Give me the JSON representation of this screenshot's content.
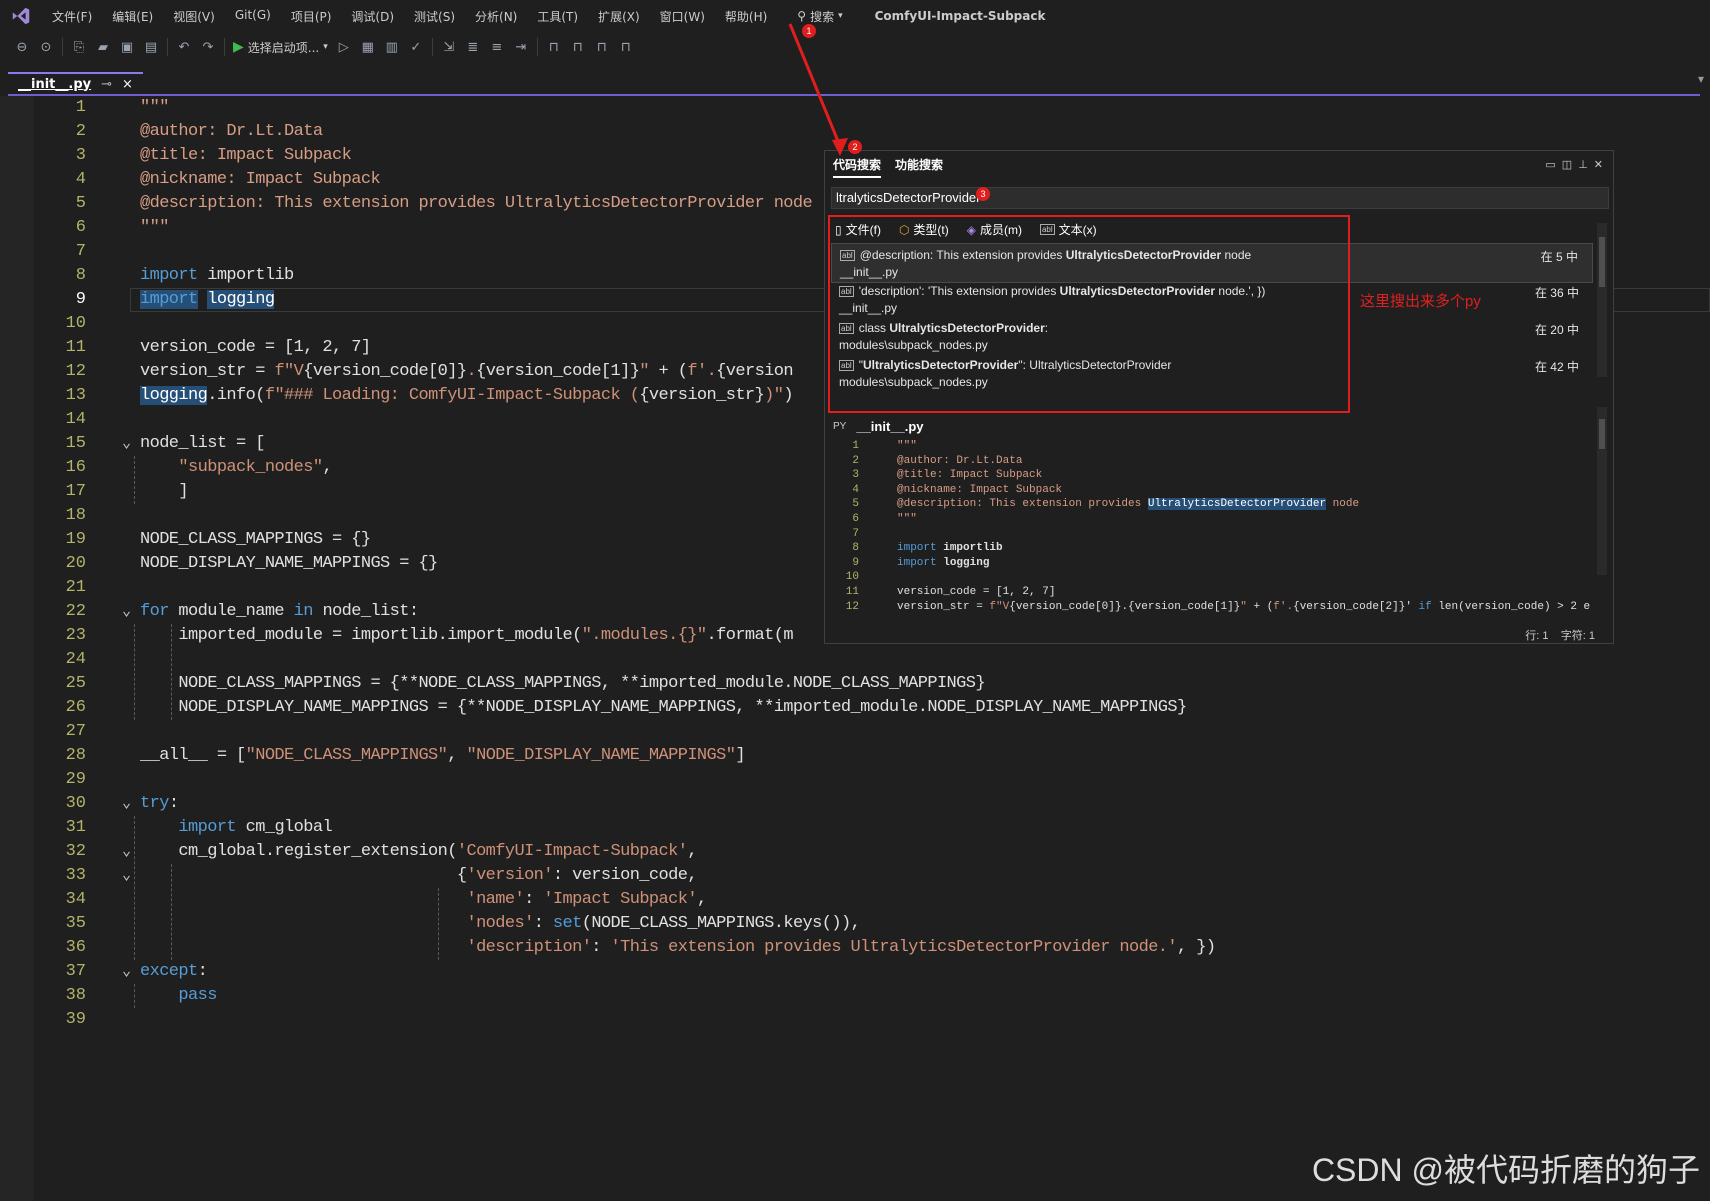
{
  "menubar": {
    "items": [
      "文件(F)",
      "编辑(E)",
      "视图(V)",
      "Git(G)",
      "项目(P)",
      "调试(D)",
      "测试(S)",
      "分析(N)",
      "工具(T)",
      "扩展(X)",
      "窗口(W)",
      "帮助(H)"
    ],
    "search_label": "搜索",
    "window_title": "ComfyUI-Impact-Subpack"
  },
  "toolbar": {
    "run_label": "选择启动项..."
  },
  "editor_tab": {
    "name": "__init__.py",
    "pin": "⊸",
    "close": "×"
  },
  "code": [
    {
      "n": "1",
      "html": "<span class='cmt'>\"\"\"</span>"
    },
    {
      "n": "2",
      "html": "<span class='cmt'>@author: Dr.Lt.Data</span>"
    },
    {
      "n": "3",
      "html": "<span class='cmt'>@title: Impact Subpack</span>"
    },
    {
      "n": "4",
      "html": "<span class='cmt'>@nickname: Impact Subpack</span>"
    },
    {
      "n": "5",
      "html": "<span class='cmt'>@description: This extension provides UltralyticsDetectorProvider node</span>"
    },
    {
      "n": "6",
      "html": "<span class='cmt'>\"\"\"</span>"
    },
    {
      "n": "7",
      "html": ""
    },
    {
      "n": "8",
      "html": "<span class='kw'>import</span> importlib"
    },
    {
      "n": "9",
      "html": "<span class='kw hl'>import</span> <span class='hl'>logging</span>"
    },
    {
      "n": "10",
      "html": ""
    },
    {
      "n": "11",
      "html": "version_code = [1, 2, 7]"
    },
    {
      "n": "12",
      "html": "version_str = <span class='str'>f\"V</span>{version_code[0]}<span class='str'>.</span>{version_code[1]}<span class='str'>\"</span> + (<span class='str'>f'.</span>{version"
    },
    {
      "n": "13",
      "html": "<span class='hl'>logging</span>.info(<span class='str'>f\"### Loading: ComfyUI-Impact-Subpack (</span>{version_str}<span class='str'>)\"</span>)"
    },
    {
      "n": "14",
      "html": ""
    },
    {
      "n": "15",
      "html": "node_list = ["
    },
    {
      "n": "16",
      "html": "    <span class='str'>\"subpack_nodes\"</span>,"
    },
    {
      "n": "17",
      "html": "    ]"
    },
    {
      "n": "18",
      "html": ""
    },
    {
      "n": "19",
      "html": "NODE_CLASS_MAPPINGS = {}"
    },
    {
      "n": "20",
      "html": "NODE_DISPLAY_NAME_MAPPINGS = {}"
    },
    {
      "n": "21",
      "html": ""
    },
    {
      "n": "22",
      "html": "<span class='kw'>for</span> module_name <span class='kw'>in</span> node_list:"
    },
    {
      "n": "23",
      "html": "    imported_module = importlib.import_module(<span class='str'>\".modules.{}\"</span>.format(m"
    },
    {
      "n": "24",
      "html": ""
    },
    {
      "n": "25",
      "html": "    NODE_CLASS_MAPPINGS = {**NODE_CLASS_MAPPINGS, **imported_module.NODE_CLASS_MAPPINGS}"
    },
    {
      "n": "26",
      "html": "    NODE_DISPLAY_NAME_MAPPINGS = {**NODE_DISPLAY_NAME_MAPPINGS, **imported_module.NODE_DISPLAY_NAME_MAPPINGS}"
    },
    {
      "n": "27",
      "html": ""
    },
    {
      "n": "28",
      "html": "__all__ = [<span class='str'>\"NODE_CLASS_MAPPINGS\"</span>, <span class='str'>\"NODE_DISPLAY_NAME_MAPPINGS\"</span>]"
    },
    {
      "n": "29",
      "html": ""
    },
    {
      "n": "30",
      "html": "<span class='kw'>try</span>:"
    },
    {
      "n": "31",
      "html": "    <span class='kw'>import</span> cm_global"
    },
    {
      "n": "32",
      "html": "    cm_global.register_extension(<span class='str'>'ComfyUI-Impact-Subpack'</span>,"
    },
    {
      "n": "33",
      "html": "                                 {<span class='str'>'version'</span>: version_code,"
    },
    {
      "n": "34",
      "html": "                                  <span class='str'>'name'</span>: <span class='str'>'Impact Subpack'</span>,"
    },
    {
      "n": "35",
      "html": "                                  <span class='str'>'nodes'</span>: <span class='kw'>set</span>(NODE_CLASS_MAPPINGS.keys()),"
    },
    {
      "n": "36",
      "html": "                                  <span class='str'>'description'</span>: <span class='str'>'This extension provides UltralyticsDetectorProvider node.'</span>, })"
    },
    {
      "n": "37",
      "html": "<span class='kw'>except</span>:"
    },
    {
      "n": "38",
      "html": "    <span class='kw'>pass</span>"
    },
    {
      "n": "39",
      "html": ""
    }
  ],
  "folds": [
    15,
    22,
    30,
    32,
    33,
    37
  ],
  "search_panel": {
    "tabs": [
      "代码搜索",
      "功能搜索"
    ],
    "query": "ltralyticsDetectorProvider",
    "filters": [
      "文件(f)",
      "类型(t)",
      "成员(m)",
      "文本(x)"
    ],
    "results": [
      {
        "pre": "@description: This extension provides ",
        "match": "UltralyticsDetectorProvider",
        "post": " node",
        "file": "__init__.py",
        "where": "在 5 中"
      },
      {
        "pre": "'description': 'This extension provides ",
        "match": "UltralyticsDetectorProvider",
        "post": " node.', })",
        "file": "__init__.py",
        "where": "在 36 中"
      },
      {
        "pre": "class ",
        "match": "UltralyticsDetectorProvider",
        "post": ":",
        "file": "modules\\subpack_nodes.py",
        "where": "在 20 中"
      },
      {
        "pre": "\"",
        "match": "UltralyticsDetectorProvider",
        "post": "\": UltralyticsDetectorProvider",
        "file": "modules\\subpack_nodes.py",
        "where": "在 42 中"
      }
    ],
    "preview_label": "PY",
    "preview_file": "__init__.py",
    "preview_lines": [
      {
        "n": "1",
        "html": "<span class='cmt'>\"\"\"</span>"
      },
      {
        "n": "2",
        "html": "<span class='cmt'>@author: Dr.Lt.Data</span>"
      },
      {
        "n": "3",
        "html": "<span class='cmt'>@title: Impact Subpack</span>"
      },
      {
        "n": "4",
        "html": "<span class='cmt'>@nickname: Impact Subpack</span>"
      },
      {
        "n": "5",
        "html": "<span class='cmt'>@description: This extension provides </span><span class='hl'>UltralyticsDetectorProvider</span><span class='cmt'> node</span>"
      },
      {
        "n": "6",
        "html": "<span class='cmt'>\"\"\"</span>"
      },
      {
        "n": "7",
        "html": ""
      },
      {
        "n": "8",
        "html": "<span class='kw'>import</span> <b>importlib</b>"
      },
      {
        "n": "9",
        "html": "<span class='kw'>import</span> <b>logging</b>"
      },
      {
        "n": "10",
        "html": ""
      },
      {
        "n": "11",
        "html": "version_code = [1, 2, 7]"
      },
      {
        "n": "12",
        "html": "version_str = <span class='str'>f\"V</span>{version_code[0]}.{version_code[1]}<span class='str'>\"</span> + (<span class='str'>f'.</span>{version_code[2]}' <span class='kw'>if</span> len(version_code) > 2 e"
      }
    ],
    "status_line": "行: 1",
    "status_char": "字符: 1"
  },
  "annotation": {
    "text": "这里搜出来多个py",
    "badges": [
      "1",
      "2",
      "3"
    ]
  },
  "watermark": "CSDN @被代码折磨的狗子"
}
